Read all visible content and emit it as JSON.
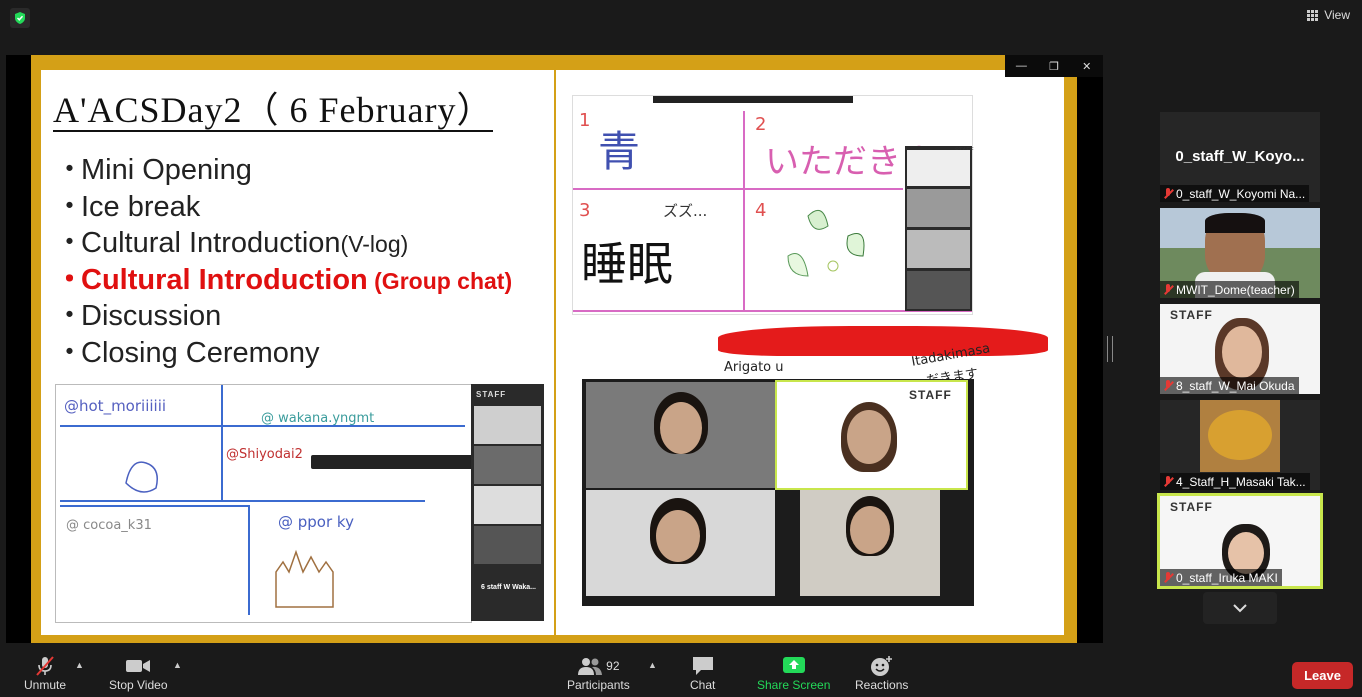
{
  "top": {
    "view_label": "View"
  },
  "slide": {
    "title": "A'ACSDay2（ 6 February）",
    "agenda": [
      {
        "bullet": "・",
        "text": "Mini Opening",
        "sub": ""
      },
      {
        "bullet": "・",
        "text": "Ice break",
        "sub": ""
      },
      {
        "bullet": "・",
        "text": "Cultural Introduction",
        "sub": "(V-log)"
      },
      {
        "bullet": "・",
        "text": "Cultural Introduction",
        "sub": " (Group chat)"
      },
      {
        "bullet": "・",
        "text": "Discussion",
        "sub": ""
      },
      {
        "bullet": "・",
        "text": "Closing Ceremony",
        "sub": ""
      }
    ],
    "whiteboard_left": {
      "handles": [
        "@hot_moriiiiii",
        "@ wakana.yngmt",
        "@Shiyodai2",
        "@ cocoa_k31",
        "@ ppor ky"
      ],
      "strip_label": "STAFF",
      "strip_name": "6 staff W Waka..."
    },
    "whiteboard_right": {
      "kanji": [
        "青",
        "いただきま",
        "睡眠",
        "ズズ..."
      ],
      "numbers": [
        "1",
        "2",
        "3",
        "4"
      ],
      "greeting_1": "Arigato u",
      "greeting_2": "Itadakimasa",
      "greeting_3": "だきます",
      "staff_label": "STAFF",
      "mini_staff": "STAFF"
    }
  },
  "participants": [
    {
      "display": "0_staff_W_Koyo...",
      "name": "0_staff_W_Koyomi Na..."
    },
    {
      "display": "",
      "name": "MWIT_Dome(teacher)"
    },
    {
      "display": "STAFF",
      "name": "8_staff_W_Mai Okuda"
    },
    {
      "display": "",
      "name": "4_Staff_H_Masaki Tak..."
    },
    {
      "display": "STAFF",
      "name": "0_staff_Iruka MAKI"
    }
  ],
  "toolbar": {
    "unmute": "Unmute",
    "stop_video": "Stop Video",
    "participants": "Participants",
    "participants_count": "92",
    "chat": "Chat",
    "share_screen": "Share Screen",
    "reactions": "Reactions",
    "leave": "Leave"
  },
  "colors": {
    "share_green": "#23d959",
    "leave_red": "#c62828",
    "frame_gold": "#d4a017",
    "active_speaker": "#c8e64c"
  }
}
